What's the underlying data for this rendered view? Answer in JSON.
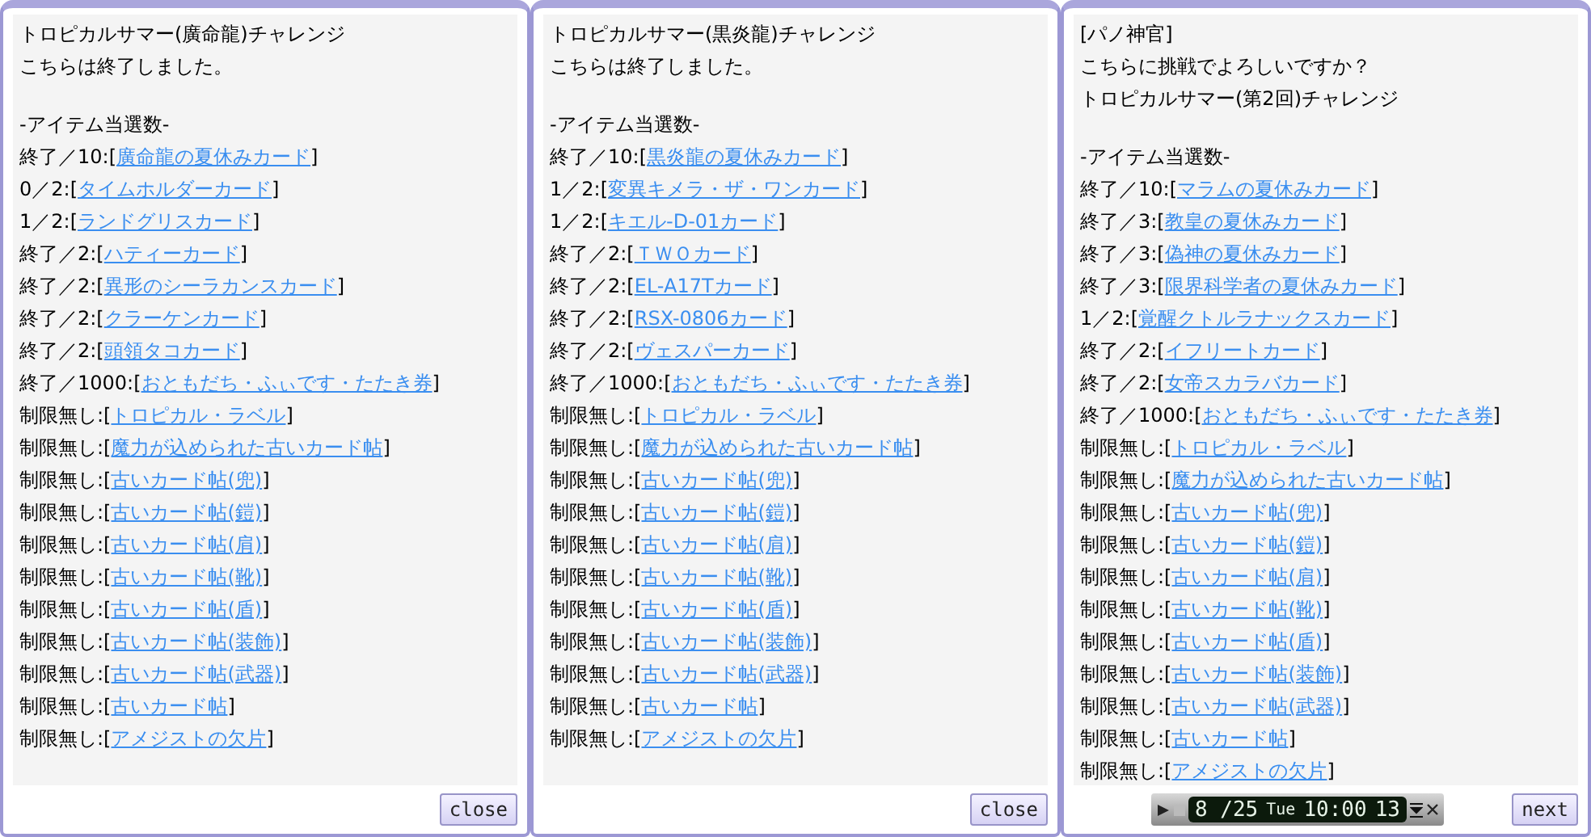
{
  "panels": [
    {
      "header_lines": [
        "トロピカルサマー(廣命龍)チャレンジ",
        "こちらは終了しました。"
      ],
      "section_title": "-アイテム当選数-",
      "items": [
        {
          "prefix": "終了／10:[",
          "link": "廣命龍の夏休みカード",
          "suffix": "]"
        },
        {
          "prefix": "0／2:[",
          "link": "タイムホルダーカード",
          "suffix": "]"
        },
        {
          "prefix": "1／2:[",
          "link": "ランドグリスカード",
          "suffix": "]"
        },
        {
          "prefix": "終了／2:[",
          "link": "ハティーカード",
          "suffix": "]"
        },
        {
          "prefix": "終了／2:[",
          "link": "異形のシーラカンスカード",
          "suffix": "]"
        },
        {
          "prefix": "終了／2:[",
          "link": "クラーケンカード",
          "suffix": "]"
        },
        {
          "prefix": "終了／2:[",
          "link": "頭領タコカード",
          "suffix": "]"
        },
        {
          "prefix": "終了／1000:[",
          "link": "おともだち・ふぃです・たたき券",
          "suffix": "]"
        },
        {
          "prefix": "制限無し:[",
          "link": "トロピカル・ラベル",
          "suffix": "]"
        },
        {
          "prefix": "制限無し:[",
          "link": "魔力が込められた古いカード帖",
          "suffix": "]"
        },
        {
          "prefix": "制限無し:[",
          "link": "古いカード帖(兜)",
          "suffix": "]"
        },
        {
          "prefix": "制限無し:[",
          "link": "古いカード帖(鎧)",
          "suffix": "]"
        },
        {
          "prefix": "制限無し:[",
          "link": "古いカード帖(肩)",
          "suffix": "]"
        },
        {
          "prefix": "制限無し:[",
          "link": "古いカード帖(靴)",
          "suffix": "]"
        },
        {
          "prefix": "制限無し:[",
          "link": "古いカード帖(盾)",
          "suffix": "]"
        },
        {
          "prefix": "制限無し:[",
          "link": "古いカード帖(装飾)",
          "suffix": "]"
        },
        {
          "prefix": "制限無し:[",
          "link": "古いカード帖(武器)",
          "suffix": "]"
        },
        {
          "prefix": "制限無し:[",
          "link": "古いカード帖",
          "suffix": "]"
        },
        {
          "prefix": "制限無し:[",
          "link": "アメジストの欠片",
          "suffix": "]"
        }
      ],
      "button": "close"
    },
    {
      "header_lines": [
        "トロピカルサマー(黒炎龍)チャレンジ",
        "こちらは終了しました。"
      ],
      "section_title": "-アイテム当選数-",
      "items": [
        {
          "prefix": "終了／10:[",
          "link": "黒炎龍の夏休みカード",
          "suffix": "]"
        },
        {
          "prefix": "1／2:[",
          "link": "変異キメラ・ザ・ワンカード",
          "suffix": "]"
        },
        {
          "prefix": "1／2:[",
          "link": "キエル-D-01カード",
          "suffix": "]"
        },
        {
          "prefix": "終了／2:[",
          "link": "ＴＷＯカード",
          "suffix": "]"
        },
        {
          "prefix": "終了／2:[",
          "link": "EL-A17Tカード",
          "suffix": "]"
        },
        {
          "prefix": "終了／2:[",
          "link": "RSX-0806カード",
          "suffix": "]"
        },
        {
          "prefix": "終了／2:[",
          "link": "ヴェスパーカード",
          "suffix": "]"
        },
        {
          "prefix": "終了／1000:[",
          "link": "おともだち・ふぃです・たたき券",
          "suffix": "]"
        },
        {
          "prefix": "制限無し:[",
          "link": "トロピカル・ラベル",
          "suffix": "]"
        },
        {
          "prefix": "制限無し:[",
          "link": "魔力が込められた古いカード帖",
          "suffix": "]"
        },
        {
          "prefix": "制限無し:[",
          "link": "古いカード帖(兜)",
          "suffix": "]"
        },
        {
          "prefix": "制限無し:[",
          "link": "古いカード帖(鎧)",
          "suffix": "]"
        },
        {
          "prefix": "制限無し:[",
          "link": "古いカード帖(肩)",
          "suffix": "]"
        },
        {
          "prefix": "制限無し:[",
          "link": "古いカード帖(靴)",
          "suffix": "]"
        },
        {
          "prefix": "制限無し:[",
          "link": "古いカード帖(盾)",
          "suffix": "]"
        },
        {
          "prefix": "制限無し:[",
          "link": "古いカード帖(装飾)",
          "suffix": "]"
        },
        {
          "prefix": "制限無し:[",
          "link": "古いカード帖(武器)",
          "suffix": "]"
        },
        {
          "prefix": "制限無し:[",
          "link": "古いカード帖",
          "suffix": "]"
        },
        {
          "prefix": "制限無し:[",
          "link": "アメジストの欠片",
          "suffix": "]"
        }
      ],
      "button": "close"
    },
    {
      "header_lines": [
        "[パノ神官]",
        "こちらに挑戦でよろしいですか？",
        "トロピカルサマー(第2回)チャレンジ"
      ],
      "section_title": "-アイテム当選数-",
      "items": [
        {
          "prefix": "終了／10:[",
          "link": "マラムの夏休みカード",
          "suffix": "]"
        },
        {
          "prefix": "終了／3:[",
          "link": "教皇の夏休みカード",
          "suffix": "]"
        },
        {
          "prefix": "終了／3:[",
          "link": "偽神の夏休みカード",
          "suffix": "]"
        },
        {
          "prefix": "終了／3:[",
          "link": "限界科学者の夏休みカード",
          "suffix": "]"
        },
        {
          "prefix": "1／2:[",
          "link": "覚醒クトルラナックスカード",
          "suffix": "]"
        },
        {
          "prefix": "終了／2:[",
          "link": "イフリートカード",
          "suffix": "]"
        },
        {
          "prefix": "終了／2:[",
          "link": "女帝スカラバカード",
          "suffix": "]"
        },
        {
          "prefix": "終了／1000:[",
          "link": "おともだち・ふぃです・たたき券",
          "suffix": "]"
        },
        {
          "prefix": "制限無し:[",
          "link": "トロピカル・ラベル",
          "suffix": "]"
        },
        {
          "prefix": "制限無し:[",
          "link": "魔力が込められた古いカード帖",
          "suffix": "]"
        },
        {
          "prefix": "制限無し:[",
          "link": "古いカード帖(兜)",
          "suffix": "]"
        },
        {
          "prefix": "制限無し:[",
          "link": "古いカード帖(鎧)",
          "suffix": "]"
        },
        {
          "prefix": "制限無し:[",
          "link": "古いカード帖(肩)",
          "suffix": "]"
        },
        {
          "prefix": "制限無し:[",
          "link": "古いカード帖(靴)",
          "suffix": "]"
        },
        {
          "prefix": "制限無し:[",
          "link": "古いカード帖(盾)",
          "suffix": "]"
        },
        {
          "prefix": "制限無し:[",
          "link": "古いカード帖(装飾)",
          "suffix": "]"
        },
        {
          "prefix": "制限無し:[",
          "link": "古いカード帖(武器)",
          "suffix": "]"
        },
        {
          "prefix": "制限無し:[",
          "link": "古いカード帖",
          "suffix": "]"
        },
        {
          "prefix": "制限無し:[",
          "link": "アメジストの欠片",
          "suffix": "]"
        }
      ],
      "button": "next",
      "clock": {
        "date": "8 /25",
        "day": "Tue",
        "time": "10:00",
        "seconds": "13"
      }
    }
  ]
}
